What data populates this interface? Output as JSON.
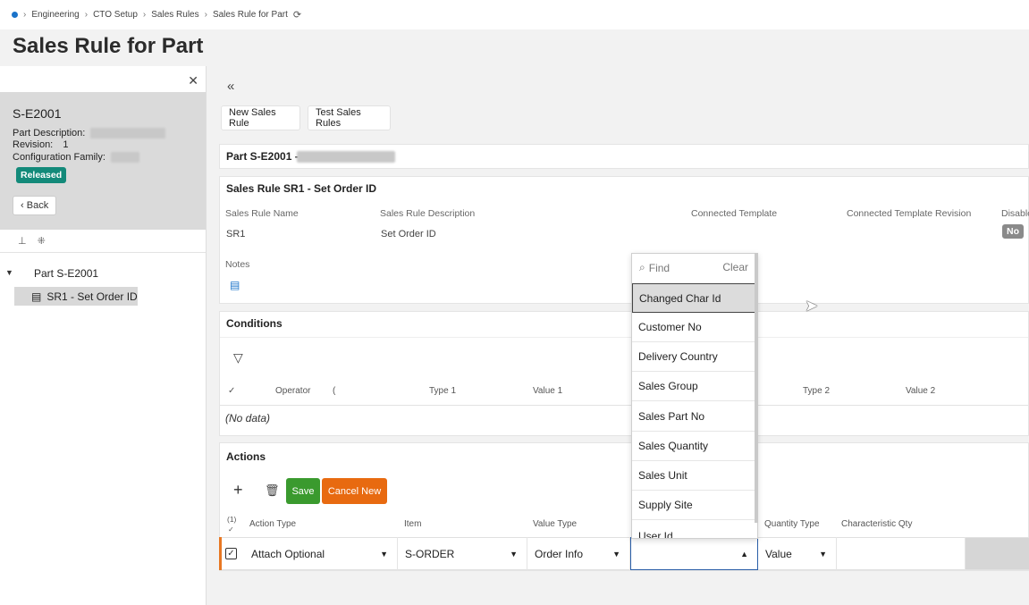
{
  "breadcrumb": [
    "Engineering",
    "CTO Setup",
    "Sales Rules",
    "Sales Rule for Part"
  ],
  "page_title": "Sales Rule for Part",
  "left": {
    "part_id": "S-E2001",
    "part_description_label": "Part Description:",
    "revision_label": "Revision:",
    "revision_value": "1",
    "config_family_label": "Configuration Family:",
    "status": "Released",
    "back_label": "Back",
    "tree_root": "Part S-E2001",
    "tree_child": "SR1 - Set Order ID"
  },
  "toolbar": {
    "new_rule": "New Sales Rule",
    "test_rules": "Test Sales Rules"
  },
  "part_header": "Part S-E2001 -",
  "sales_rule": {
    "title": "Sales Rule SR1 - Set Order ID",
    "name_label": "Sales Rule Name",
    "name_value": "SR1",
    "desc_label": "Sales Rule Description",
    "desc_value": "Set Order ID",
    "template_label": "Connected Template",
    "template_rev_label": "Connected Template Revision",
    "disabled_label": "Disable",
    "disabled_value": "No",
    "notes_label": "Notes"
  },
  "conditions": {
    "title": "Conditions",
    "columns": [
      "Operator",
      "(",
      "Type 1",
      "Value 1",
      "Type 2",
      "Value 2"
    ],
    "empty": "(No data)"
  },
  "actions": {
    "title": "Actions",
    "save": "Save",
    "cancel_new": "Cancel New",
    "count": "(1)",
    "columns": [
      "Action Type",
      "Item",
      "Value Type",
      "Quantity Type",
      "Characteristic Qty"
    ],
    "row": {
      "action_type": "Attach Optional",
      "item": "S-ORDER",
      "value_type": "Order Info",
      "value": "",
      "quantity_type": "Value"
    }
  },
  "dropdown": {
    "search_placeholder": "Find",
    "clear": "Clear",
    "options": [
      "Changed Char Id",
      "Customer No",
      "Delivery Country",
      "Sales Group",
      "Sales Part No",
      "Sales Quantity",
      "Sales Unit",
      "Supply Site",
      "User Id"
    ],
    "selected": "Changed Char Id"
  },
  "colors": {
    "accent": "#1a73c9",
    "released": "#138a7a",
    "save": "#3a9a2e",
    "cancel": "#e86a10",
    "row_marker": "#e87722"
  }
}
